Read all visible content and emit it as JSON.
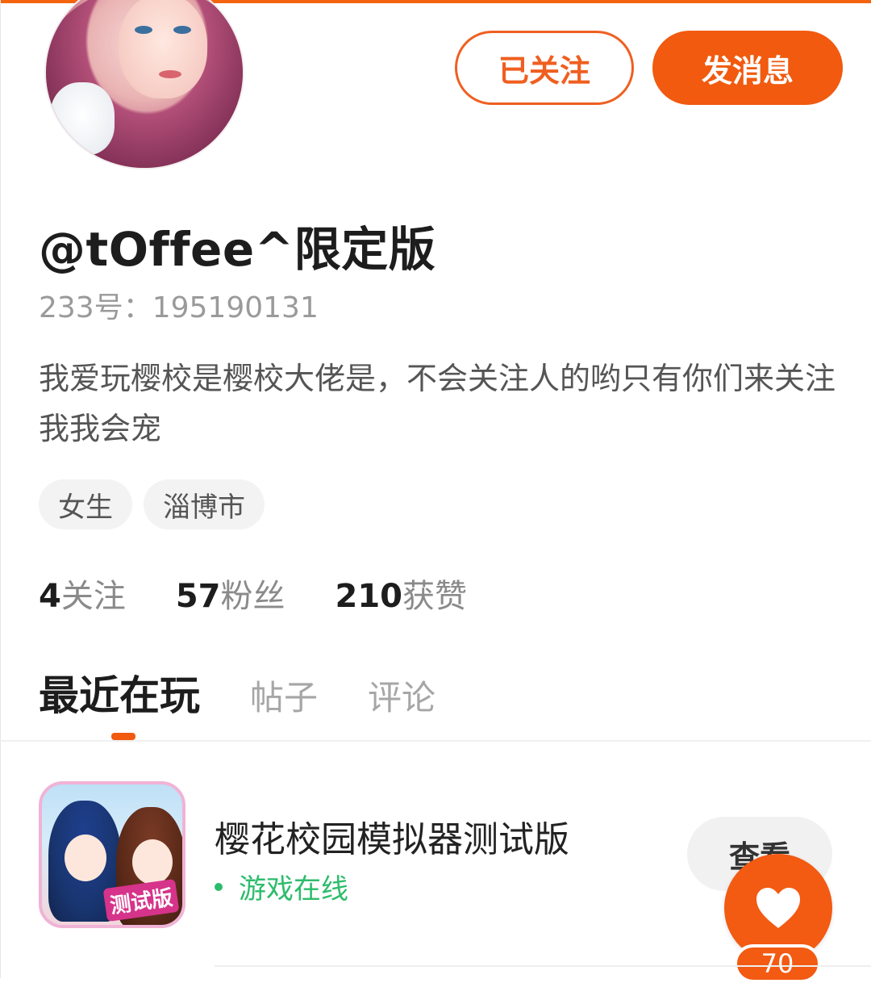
{
  "profile": {
    "name": "@tOffee^限定版",
    "id_line": "233号：195190131",
    "bio": "我爱玩樱校是樱校大佬是，不会关注人的哟只有你们来关注我我会宠",
    "tags": [
      "女生",
      "淄博市"
    ]
  },
  "actions": {
    "follow_label": "已关注",
    "message_label": "发消息"
  },
  "stats": [
    {
      "value": "4",
      "label": "关注"
    },
    {
      "value": "57",
      "label": "粉丝"
    },
    {
      "value": "210",
      "label": "获赞"
    }
  ],
  "tabs": [
    {
      "label": "最近在玩",
      "active": true
    },
    {
      "label": "帖子",
      "active": false
    },
    {
      "label": "评论",
      "active": false
    }
  ],
  "game": {
    "title": "樱花校园模拟器测试版",
    "status": "游戏在线",
    "icon_badge": "测试版",
    "view_label": "查看"
  },
  "like_fab": {
    "count": "70",
    "icon": "heart-icon"
  },
  "colors": {
    "accent": "#f15a0f",
    "online": "#2dbc6c"
  }
}
